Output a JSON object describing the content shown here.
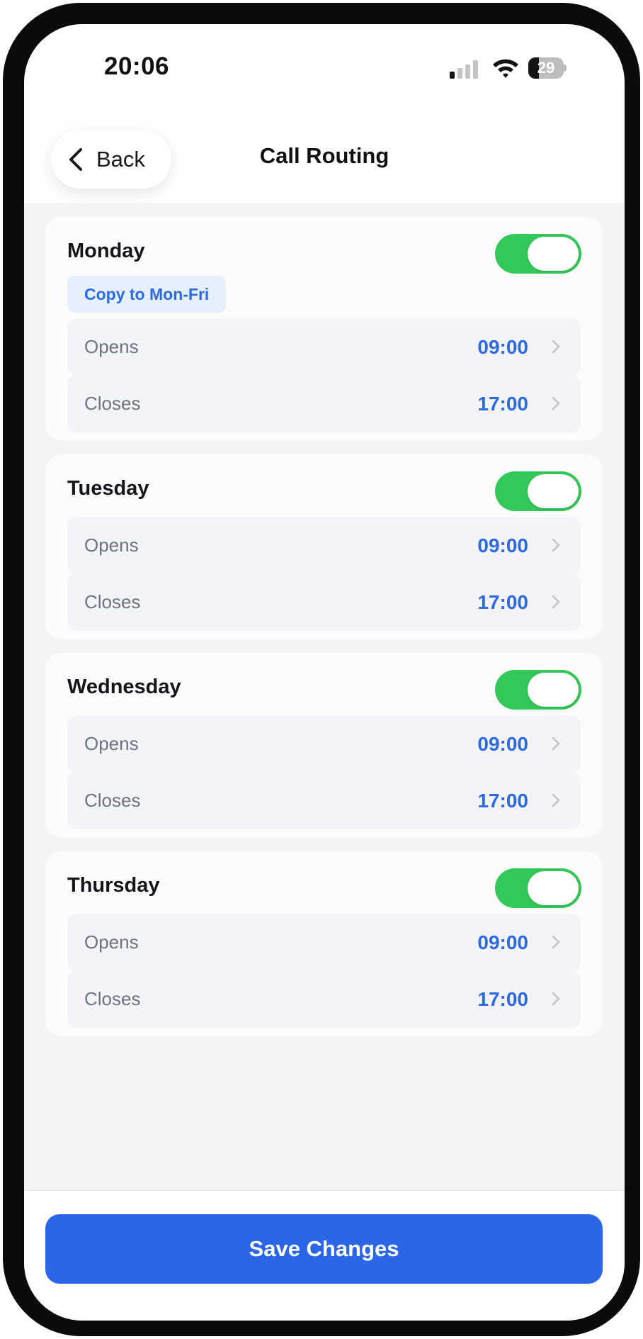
{
  "status_bar": {
    "time": "20:06",
    "battery": "29",
    "battery_level": 0.29
  },
  "header": {
    "back_label": "Back",
    "title": "Call Routing"
  },
  "days": [
    {
      "name": "Monday",
      "enabled": true,
      "copy_label": "Copy to Mon-Fri",
      "opens_label": "Opens",
      "opens": "09:00",
      "closes_label": "Closes",
      "closes": "17:00"
    },
    {
      "name": "Tuesday",
      "enabled": true,
      "opens_label": "Opens",
      "opens": "09:00",
      "closes_label": "Closes",
      "closes": "17:00"
    },
    {
      "name": "Wednesday",
      "enabled": true,
      "opens_label": "Opens",
      "opens": "09:00",
      "closes_label": "Closes",
      "closes": "17:00"
    },
    {
      "name": "Thursday",
      "enabled": true,
      "opens_label": "Opens",
      "opens": "09:00",
      "closes_label": "Closes",
      "closes": "17:00"
    }
  ],
  "footer": {
    "save_label": "Save Changes"
  },
  "colors": {
    "accent": "#2c66e8",
    "toggle_on": "#34c759",
    "value_text": "#2d6ae0"
  }
}
